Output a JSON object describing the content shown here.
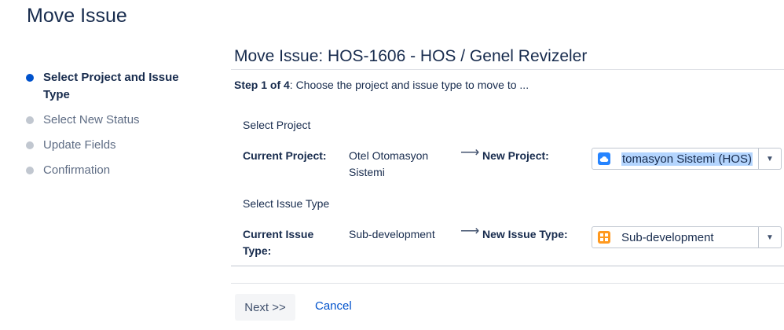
{
  "page": {
    "title": "Move Issue"
  },
  "steps": [
    {
      "label": "Select Project and Issue Type",
      "active": true
    },
    {
      "label": "Select New Status",
      "active": false
    },
    {
      "label": "Update Fields",
      "active": false
    },
    {
      "label": "Confirmation",
      "active": false
    }
  ],
  "main": {
    "title": "Move Issue: HOS-1606 - HOS / Genel Revizeler",
    "step_prefix": "Step 1 of 4",
    "step_text": ": Choose the project and issue type to move to ...",
    "project": {
      "section": "Select Project",
      "current_label": "Current Project:",
      "current_value": "Otel Otomasyon Sistemi",
      "arrow": "⟶",
      "new_label": "New Project:",
      "new_value": "tomasyon Sistemi (HOS)",
      "icon": "cloud-project-icon"
    },
    "issue_type": {
      "section": "Select Issue Type",
      "current_label": "Current Issue Type:",
      "current_value": "Sub-development",
      "arrow": "⟶",
      "new_label": "New Issue Type:",
      "new_value": "Sub-development",
      "icon": "subtask-icon"
    }
  },
  "actions": {
    "next": "Next >>",
    "cancel": "Cancel"
  },
  "colors": {
    "accent": "#0052cc",
    "selection": "#b4d5fe",
    "subtask_icon": "#ff991f"
  }
}
